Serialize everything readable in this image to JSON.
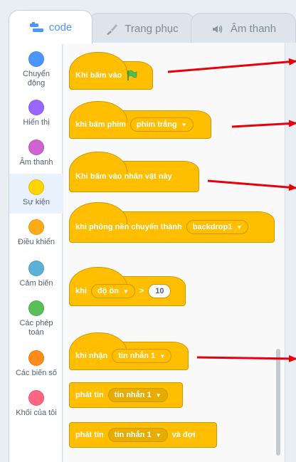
{
  "tabs": {
    "code": "code",
    "costume": "Trang phục",
    "sound": "Âm thanh"
  },
  "categories": [
    {
      "label": "Chuyển\nđộng",
      "color": "#4c97ff"
    },
    {
      "label": "Hiển thị",
      "color": "#9966ff"
    },
    {
      "label": "Âm thanh",
      "color": "#cf63cf"
    },
    {
      "label": "Sự kiện",
      "color": "#ffd500"
    },
    {
      "label": "Điều khiển",
      "color": "#ffab19"
    },
    {
      "label": "Cảm biến",
      "color": "#5cb1d6"
    },
    {
      "label": "Các phép\ntoán",
      "color": "#59c059"
    },
    {
      "label": "Các biến số",
      "color": "#ff8c1a"
    },
    {
      "label": "Khối của tôi",
      "color": "#ff6680"
    }
  ],
  "blocks": {
    "when_flag": "Khi bấm vào",
    "when_key": "khi bấm phím",
    "key_option": "phím trắng",
    "when_sprite": "Khi bấm vào nhân vật này",
    "when_backdrop": "khi phông nền chuyển thành",
    "backdrop_option": "backdrop1",
    "when_label": "khi",
    "sensor_option": "độ ồn",
    "greater": ">",
    "threshold": "10",
    "when_receive": "khi nhận",
    "receive_option": "tin nhắn 1",
    "broadcast": "phát tin",
    "broadcast_option": "tin nhắn 1",
    "broadcast_wait": "phát tin",
    "broadcast_wait_option": "tin nhắn 1",
    "and_wait": "và đợi"
  },
  "colors": {
    "events": "#ffbf00",
    "events_border": "#cc9900",
    "arrow": "#e8000b",
    "accent": "#4c97ff"
  }
}
